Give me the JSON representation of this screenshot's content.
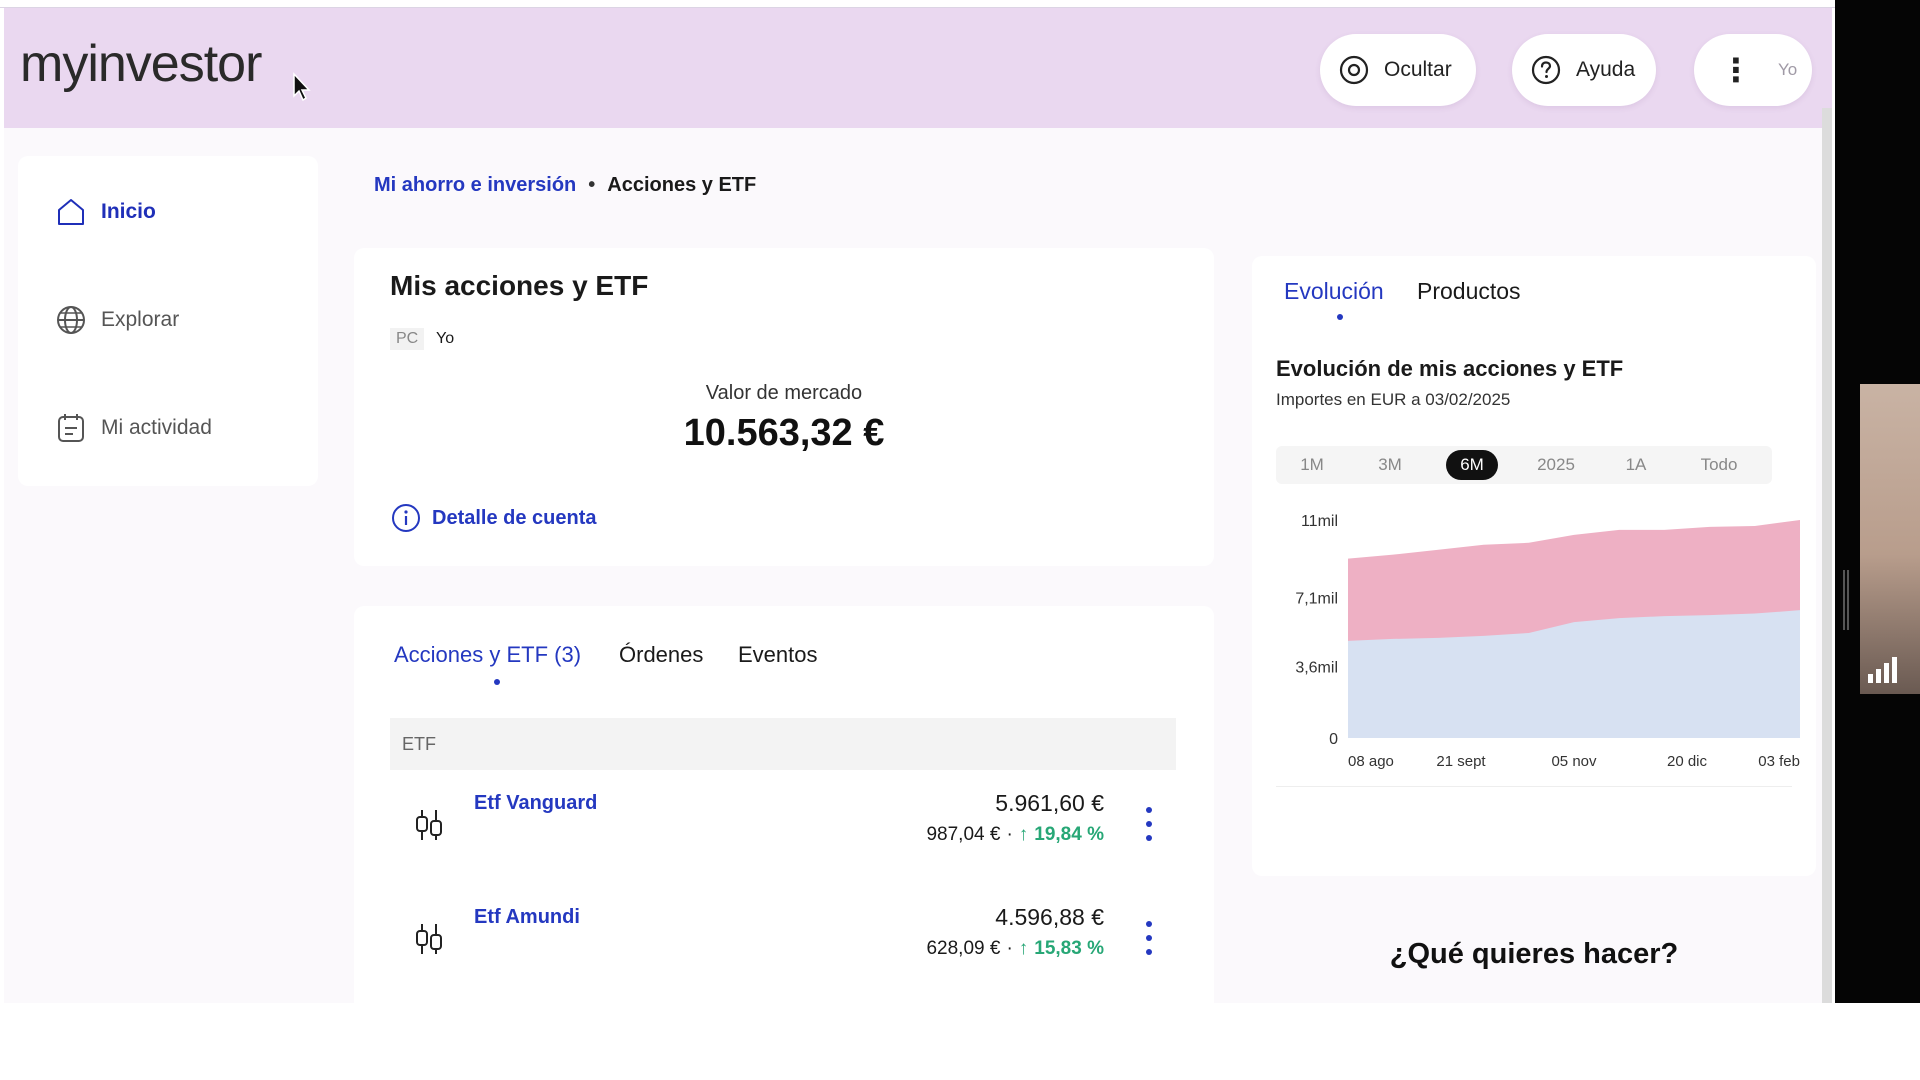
{
  "header": {
    "logo": "myinvestor",
    "hide_label": "Ocultar",
    "help_label": "Ayuda",
    "user_label": "Yo"
  },
  "sidebar": {
    "items": [
      {
        "label": "Inicio",
        "icon": "home-icon",
        "active": true
      },
      {
        "label": "Explorar",
        "icon": "globe-icon",
        "active": false
      },
      {
        "label": "Mi actividad",
        "icon": "calendar-icon",
        "active": false
      }
    ]
  },
  "breadcrumb": {
    "link": "Mi ahorro e inversión",
    "separator": "•",
    "current": "Acciones y ETF"
  },
  "summary": {
    "title": "Mis acciones y ETF",
    "tag_pc": "PC",
    "tag_owner": "Yo",
    "market_label": "Valor de mercado",
    "market_value": "10.563,32 €",
    "detail_link": "Detalle de cuenta"
  },
  "holdings": {
    "tabs": [
      "Acciones y ETF (3)",
      "Órdenes",
      "Eventos"
    ],
    "active_tab": 0,
    "section_header": "ETF",
    "rows": [
      {
        "name": "Etf Vanguard",
        "value": "5.961,60 €",
        "gain": "987,04 €",
        "pct": "19,84 %"
      },
      {
        "name": "Etf Amundi",
        "value": "4.596,88 €",
        "gain": "628,09 €",
        "pct": "15,83 %"
      }
    ]
  },
  "evolution": {
    "tabs": [
      "Evolución",
      "Productos"
    ],
    "active_tab": 0,
    "title": "Evolución de mis acciones y ETF",
    "subtitle": "Importes en EUR a 03/02/2025",
    "ranges": [
      "1M",
      "3M",
      "6M",
      "2025",
      "1A",
      "Todo"
    ],
    "active_range": "6M"
  },
  "chart_data": {
    "type": "area",
    "x_ticks": [
      "08 ago",
      "21 sept",
      "05 nov",
      "20 dic",
      "03 feb"
    ],
    "y_ticks": [
      "0",
      "3,6mil",
      "7,1mil",
      "11mil"
    ],
    "ylim": [
      0,
      11000
    ],
    "x": [
      0,
      0.1,
      0.2,
      0.3,
      0.4,
      0.5,
      0.6,
      0.7,
      0.8,
      0.9,
      1.0
    ],
    "series": [
      {
        "color": "#d7e1f2",
        "values": [
          4900,
          5000,
          5050,
          5150,
          5300,
          5850,
          6050,
          6150,
          6200,
          6280,
          6450
        ]
      },
      {
        "color": "#eeb0c4",
        "values": [
          9050,
          9250,
          9500,
          9750,
          9850,
          10250,
          10500,
          10500,
          10650,
          10700,
          11000
        ]
      }
    ],
    "grid": false,
    "legend": "none"
  },
  "cta": {
    "title": "¿Qué quieres hacer?"
  },
  "colors": {
    "header_bg": "#ead8f0",
    "link_blue": "#2438c0",
    "gain_green": "#27a776",
    "area_invested": "#d7e1f2",
    "area_gain": "#eeb0c4"
  }
}
